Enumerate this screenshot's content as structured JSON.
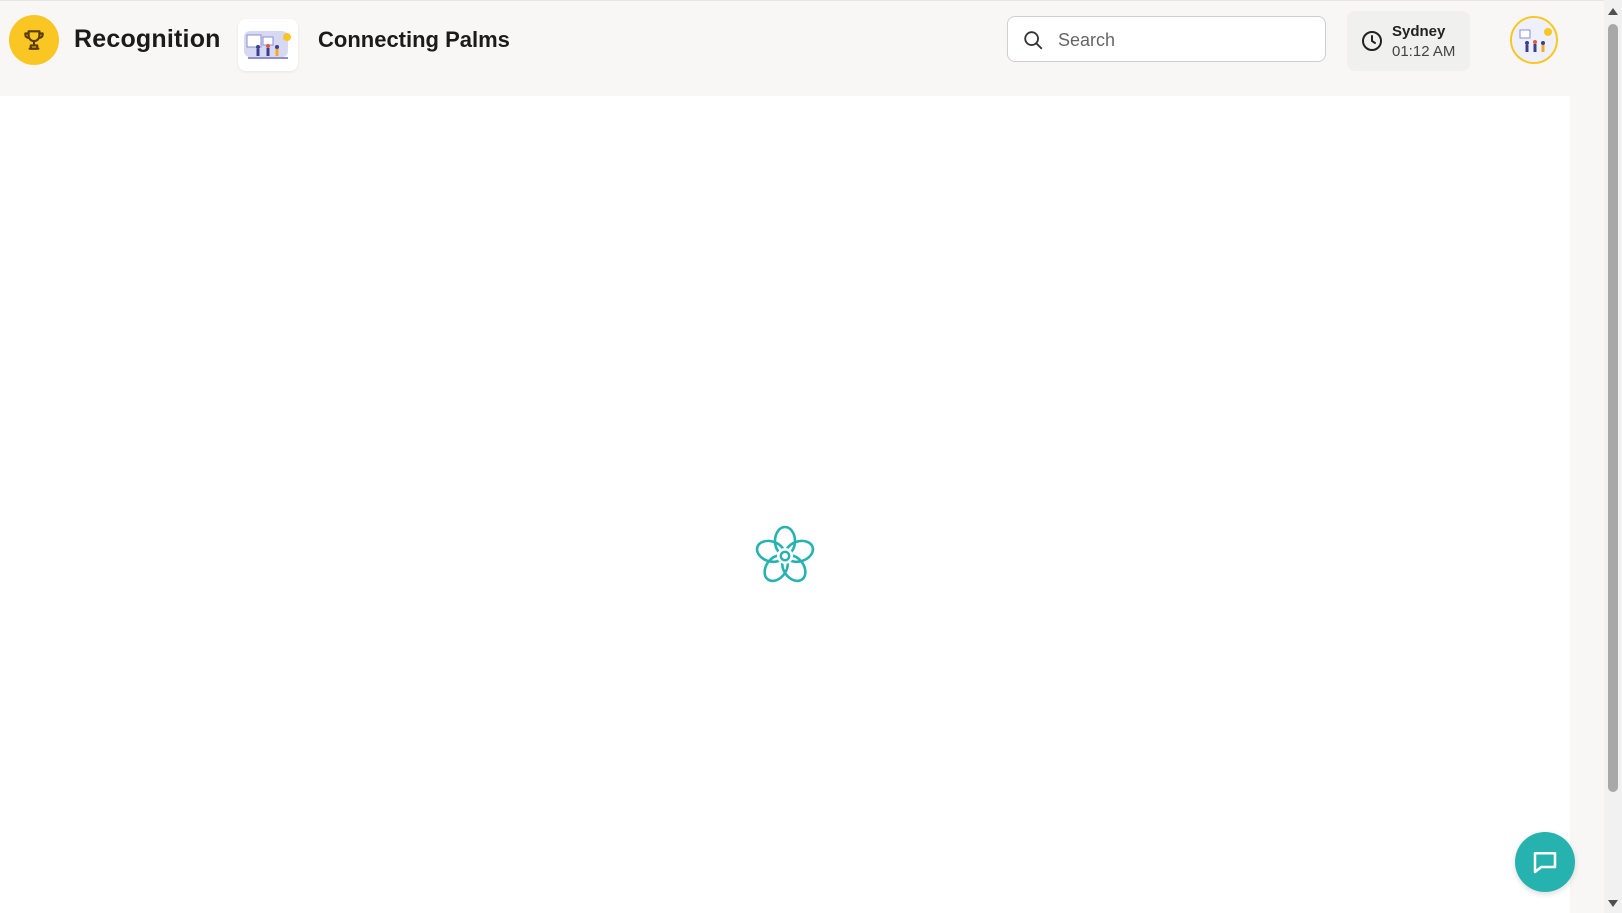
{
  "header": {
    "app_title": "Recognition",
    "team_name": "Connecting Palms",
    "search": {
      "placeholder": "Search",
      "value": ""
    },
    "clock": {
      "city": "Sydney",
      "time": "01:12 AM"
    }
  },
  "icons": {
    "brand": "trophy-icon",
    "search": "search-icon",
    "clock": "clock-icon",
    "loader": "flower-loader-icon",
    "chat": "chat-bubble-icon"
  },
  "colors": {
    "accent_yellow": "#f9c623",
    "teal": "#26b3b0",
    "header_bg": "#f8f7f6",
    "content_bg": "#ffffff"
  }
}
